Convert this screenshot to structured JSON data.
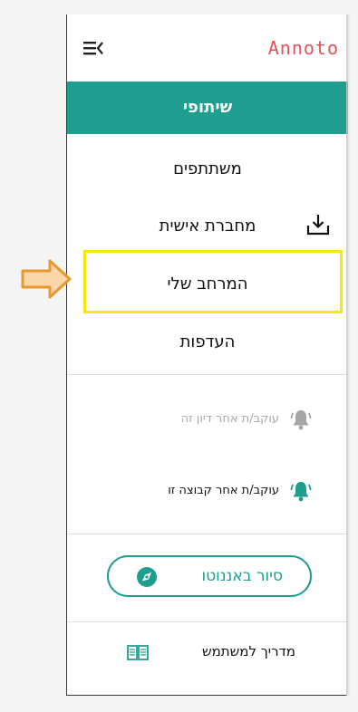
{
  "app": {
    "logo": "Annoto"
  },
  "menu": {
    "items": [
      {
        "label": "שיתופי",
        "active": true
      },
      {
        "label": "משתתפים"
      },
      {
        "label": "מחברת אישית",
        "icon": "download-icon"
      },
      {
        "label": "המרחב שלי",
        "highlighted": true
      },
      {
        "label": "העדפות"
      }
    ]
  },
  "follow": {
    "discussion": {
      "label": "עוקב/ת אחר דיון זה",
      "enabled": false
    },
    "group": {
      "label": "עוקב/ת אחר קבוצה זו",
      "enabled": true
    }
  },
  "tour": {
    "label": "סיור באננוטו"
  },
  "guide": {
    "label": "מדריך למשתמש"
  },
  "colors": {
    "accent": "#1f9e8f",
    "brand": "#e8505b",
    "highlight": "#f2ea0f",
    "arrow": "#e59a2e"
  }
}
